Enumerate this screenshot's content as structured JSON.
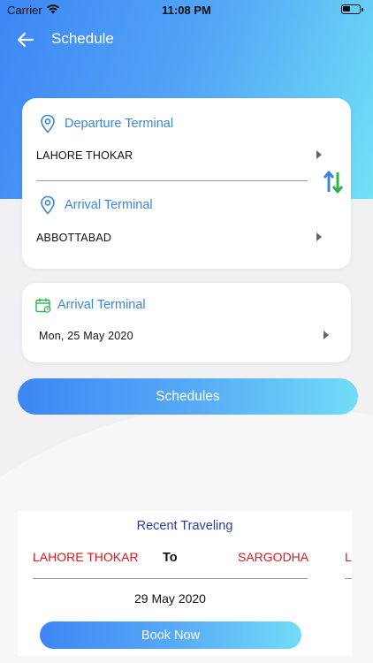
{
  "status_bar": {
    "carrier": "Carrier",
    "time": "11:08 PM"
  },
  "nav": {
    "title": "Schedule",
    "back_icon": "arrow-left-icon"
  },
  "departure": {
    "label": "Departure Terminal",
    "value": "LAHORE THOKAR",
    "icon": "location-pin-icon"
  },
  "arrival": {
    "label": "Arrival Terminal",
    "value": "ABBOTTABAD",
    "icon": "location-pin-icon"
  },
  "swap": {
    "icon": "swap-arrows-icon",
    "up_color": "#3a86d9",
    "down_color": "#2db34a"
  },
  "date_card": {
    "label": "Arrival Terminal",
    "value": "Mon, 25 May 2020",
    "icon": "calendar-icon"
  },
  "schedules_button": {
    "label": "Schedules"
  },
  "recent": {
    "title": "Recent Traveling",
    "from": "LAHORE THOKAR",
    "to_label": "To",
    "destination": "SARGODHA",
    "next_from_partial": "L",
    "date": "29 May 2020",
    "book_button": "Book Now"
  },
  "colors": {
    "gradient_start": "#3d86f5",
    "gradient_end": "#6fe2f6",
    "label_blue": "#3a86d9",
    "route_red": "#e0141b",
    "recent_title_blue": "#2540a8",
    "calendar_green": "#2db34a"
  }
}
